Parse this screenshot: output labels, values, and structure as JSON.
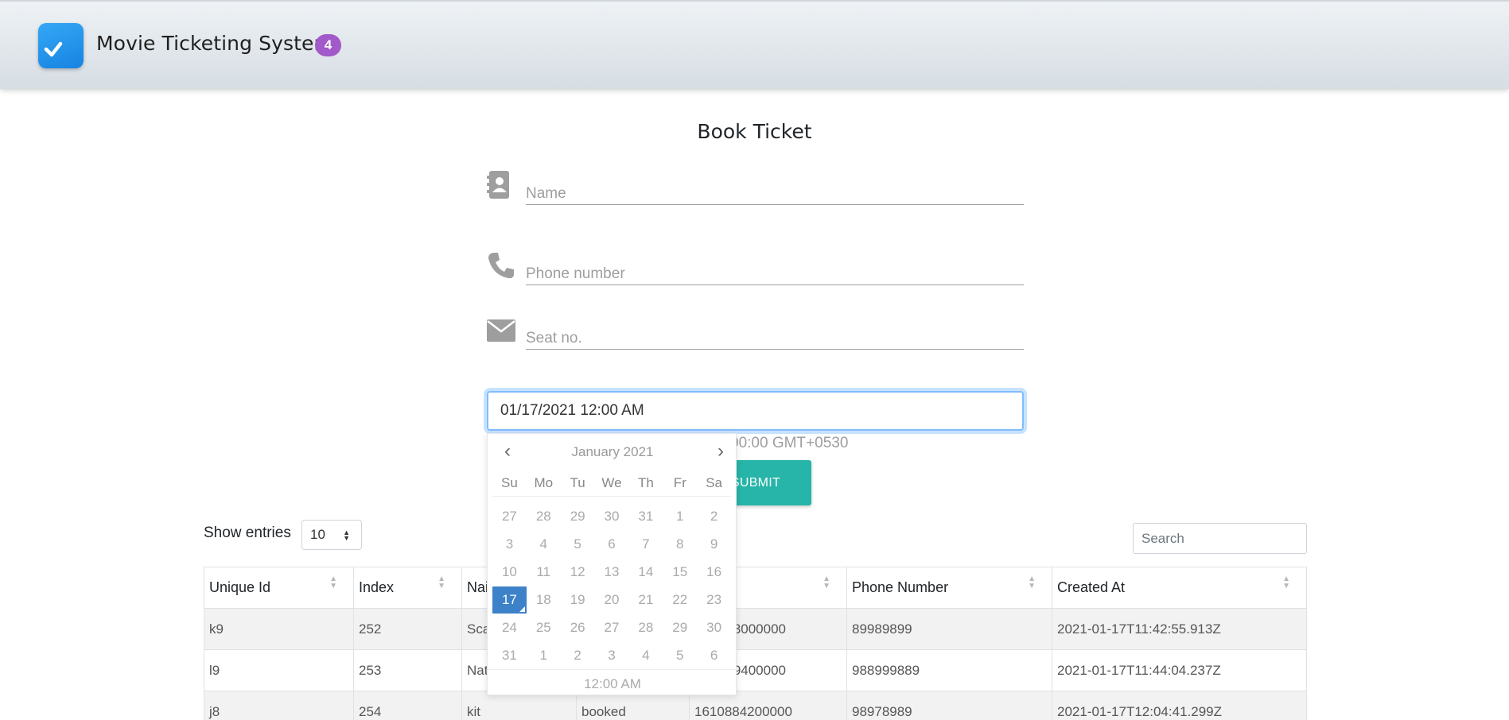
{
  "app": {
    "title": "Movie Ticketing System",
    "badge": "4",
    "accent": "#a259c9",
    "logo_color": "#1f8ee8"
  },
  "form": {
    "title": "Book Ticket",
    "name_placeholder": "Name",
    "phone_placeholder": "Phone number",
    "seat_placeholder": "Seat no.",
    "datetime_value": "01/17/2021 12:00 AM",
    "datetime_helper": "00:00 GMT+0530",
    "submit_label": "SUBMIT",
    "submit_color": "#26b5a8",
    "icons": {
      "name": "contact-book-icon",
      "phone": "phone-icon",
      "seat": "envelope-icon"
    }
  },
  "datepicker": {
    "prev": "‹",
    "next": "›",
    "month": "January 2021",
    "weekdays": [
      "Su",
      "Mo",
      "Tu",
      "We",
      "Th",
      "Fr",
      "Sa"
    ],
    "weeks": [
      [
        "27",
        "28",
        "29",
        "30",
        "31",
        "1",
        "2"
      ],
      [
        "3",
        "4",
        "5",
        "6",
        "7",
        "8",
        "9"
      ],
      [
        "10",
        "11",
        "12",
        "13",
        "14",
        "15",
        "16"
      ],
      [
        "17",
        "18",
        "19",
        "20",
        "21",
        "22",
        "23"
      ],
      [
        "24",
        "25",
        "26",
        "27",
        "28",
        "29",
        "30"
      ],
      [
        "31",
        "1",
        "2",
        "3",
        "4",
        "5",
        "6"
      ]
    ],
    "selected": "17",
    "time": "12:00 AM",
    "selected_color": "#3d82c9"
  },
  "table_controls": {
    "show_entries_label": "Show entries",
    "entries_value": "10",
    "search_placeholder": "Search"
  },
  "table": {
    "columns": [
      "Unique Id",
      "Index",
      "Nai",
      "",
      "",
      "Phone Number",
      "Created At"
    ],
    "rows": [
      [
        "k9",
        "252",
        "Sca",
        "",
        "3000000",
        "89989899",
        "2021-01-17T11:42:55.913Z"
      ],
      [
        "l9",
        "253",
        "Nat",
        "",
        "9400000",
        "988999889",
        "2021-01-17T11:44:04.237Z"
      ],
      [
        "j8",
        "254",
        "kit",
        "booked",
        "1610884200000",
        "98978989",
        "2021-01-17T12:04:41.299Z"
      ]
    ]
  }
}
